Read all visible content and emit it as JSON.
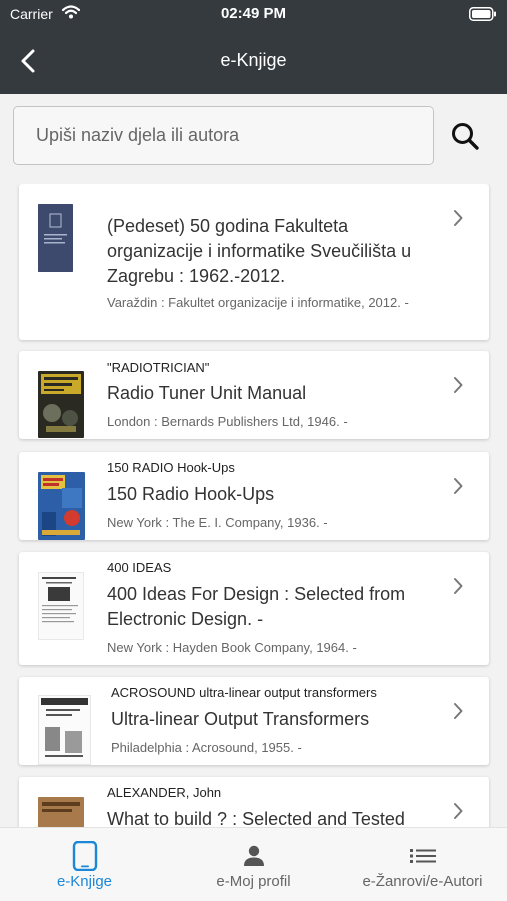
{
  "status_bar": {
    "carrier": "Carrier",
    "time": "02:49 PM"
  },
  "nav": {
    "title": "e-Knjige"
  },
  "search": {
    "placeholder": "Upiši naziv djela ili autora"
  },
  "books": [
    {
      "author": "",
      "title": "(Pedeset) 50 godina Fakulteta organizacije i informatike Sveučilišta u Zagrebu : 1962.-2012.",
      "publication": "Varaždin : Fakultet organizacije i informatike, 2012. -"
    },
    {
      "author": "\"RADIOTRICIAN\"",
      "title": "Radio Tuner Unit Manual",
      "publication": "London : Bernards Publishers Ltd, 1946. -"
    },
    {
      "author": "150 RADIO Hook-Ups",
      "title": "150 Radio Hook-Ups",
      "publication": "New York : The E. I. Company, 1936. -"
    },
    {
      "author": "400 IDEAS",
      "title": "400 Ideas For Design : Selected from Electronic Design. -",
      "publication": "New York : Hayden Book Company, 1964. -"
    },
    {
      "author": "ACROSOUND ultra-linear output transformers",
      "title": "Ultra-linear Output Transformers",
      "publication": "Philadelphia : Acrosound, 1955. -"
    },
    {
      "author": "ALEXANDER, John",
      "title": "What to build ? : Selected and Tested",
      "publication": ""
    }
  ],
  "tabs": [
    {
      "label": "e-Knjige",
      "active": true
    },
    {
      "label": "e-Moj profil",
      "active": false
    },
    {
      "label": "e-Žanrovi/e-Autori",
      "active": false
    }
  ],
  "colors": {
    "header": "#353a3f",
    "accent": "#1b87d6",
    "tab_inactive": "#666666"
  }
}
